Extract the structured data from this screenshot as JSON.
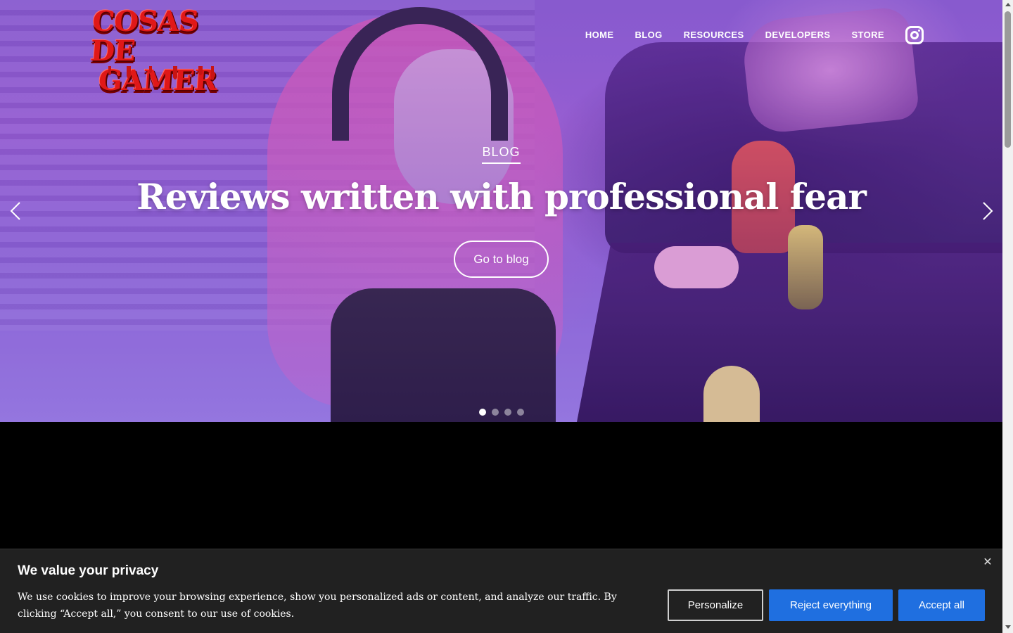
{
  "brand": {
    "logo_line1": "COSAS DE",
    "logo_line2": "GAMER"
  },
  "nav": {
    "items": [
      {
        "label": "HOME"
      },
      {
        "label": "BLOG"
      },
      {
        "label": "RESOURCES"
      },
      {
        "label": "DEVELOPERS"
      },
      {
        "label": "STORE"
      }
    ],
    "social_icon": "instagram-icon"
  },
  "hero": {
    "kicker": "BLOG",
    "headline": "Reviews written with professional fear",
    "cta_label": "Go to blog",
    "prev_icon": "chevron-left-icon",
    "next_icon": "chevron-right-icon",
    "slide_count": 4,
    "active_slide": 1
  },
  "cookie": {
    "title": "We value your privacy",
    "text": "We use cookies to improve your browsing experience, show you personalized ads or content, and analyze our traffic. By clicking “Accept all,” you consent to our use of cookies.",
    "buttons": {
      "personalize": "Personalize",
      "reject": "Reject everything",
      "accept": "Accept all"
    },
    "close_icon": "close-icon",
    "button_color": "#1f6fe0"
  },
  "colors": {
    "hero_tint": "#9a62d4",
    "logo_red": "#e01818",
    "banner_bg": "#212121"
  }
}
